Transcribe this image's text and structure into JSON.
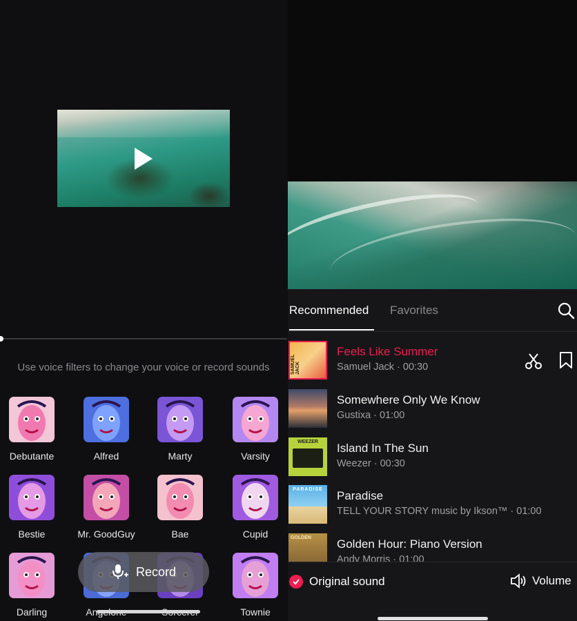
{
  "voice_panel": {
    "hint": "Use voice filters to change your voice or record sounds",
    "filters": [
      {
        "name": "Debutante",
        "bg": "#f3c6d8",
        "face": "#f07ab0"
      },
      {
        "name": "Alfred",
        "bg": "#4d6fe0",
        "face": "#7fa2ff"
      },
      {
        "name": "Marty",
        "bg": "#7a55d6",
        "face": "#c59af2"
      },
      {
        "name": "Varsity",
        "bg": "#b488f0",
        "face": "#f6a6d2"
      },
      {
        "name": "Bestie",
        "bg": "#8f4ed9",
        "face": "#e49ae4"
      },
      {
        "name": "Mr. GoodGuy",
        "bg": "#c44ea6",
        "face": "#f3a6b8"
      },
      {
        "name": "Bae",
        "bg": "#f4c2ce",
        "face": "#f28cb0"
      },
      {
        "name": "Cupid",
        "bg": "#a05be0",
        "face": "#f0d7ef"
      },
      {
        "name": "Darling",
        "bg": "#e59bd6",
        "face": "#f48fc5"
      },
      {
        "name": "Angelone",
        "bg": "#4b6bd6",
        "face": "#86a3f5"
      },
      {
        "name": "Sorcerer",
        "bg": "#6a3fc0",
        "face": "#b48ae6"
      },
      {
        "name": "Townie",
        "bg": "#c07ef0",
        "face": "#e6a0d6"
      }
    ],
    "record_label": "Record"
  },
  "music_panel": {
    "tabs": {
      "recommended": "Recommended",
      "favorites": "Favorites"
    },
    "tracks": [
      {
        "title": "Feels Like Summer",
        "meta": "Samuel Jack · 00:30",
        "cover_text": "SAMUEL JACK",
        "playing": true
      },
      {
        "title": "Somewhere Only We Know",
        "meta": "Gustixa · 01:00"
      },
      {
        "title": "Island In The Sun",
        "meta": "Weezer · 00:30",
        "cover_text": "WEEZER"
      },
      {
        "title": "Paradise",
        "meta": "TELL YOUR STORY music by Ikson™ · 01:00",
        "cover_text": "PARADISE"
      },
      {
        "title": "Golden Hour: Piano Version",
        "meta": "Andy Morris · 01:00",
        "cover_text": "GOLDEN"
      }
    ],
    "original_sound": "Original sound",
    "volume": "Volume",
    "accent": "#ee1d52"
  }
}
